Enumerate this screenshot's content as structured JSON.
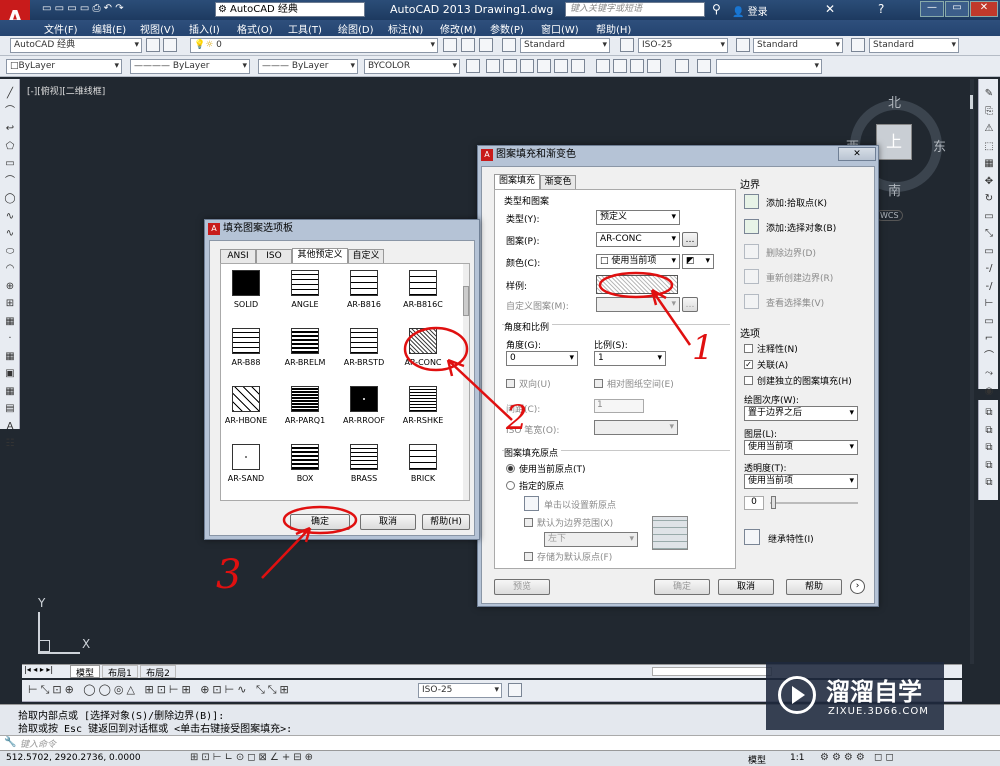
{
  "app": {
    "title_center": "AutoCAD 2013   Drawing1.dwg",
    "search_placeholder": "键入关键字或短语",
    "login_label": "登录",
    "workspace_label": "AutoCAD 经典"
  },
  "menu": [
    "文件(F)",
    "编辑(E)",
    "视图(V)",
    "插入(I)",
    "格式(O)",
    "工具(T)",
    "绘图(D)",
    "标注(N)",
    "修改(M)",
    "参数(P)",
    "窗口(W)",
    "帮助(H)"
  ],
  "toolbar": {
    "workspace_combo": "AutoCAD 经典",
    "layer_combo": "0",
    "text_style": "Standard",
    "dim_style": "ISO-25",
    "table_style": "Standard",
    "mleader_style": "Standard",
    "color_combo": "ByLayer",
    "linetype_combo": "ByLayer",
    "lineweight_combo": "ByLayer",
    "plotstyle_combo": "BYCOLOR"
  },
  "viewport_label": "[-][俯视][二维线框]",
  "viewcube": {
    "north": "北",
    "south": "南",
    "east": "东",
    "west": "西",
    "top": "上",
    "wcs": "WCS"
  },
  "ucs": {
    "x": "X",
    "y": "Y"
  },
  "hatch_dialog": {
    "title": "图案填充和渐变色",
    "tabs": [
      "图案填充",
      "渐变色"
    ],
    "type_group": "类型和图案",
    "type_label": "类型(Y):",
    "type_value": "预定义",
    "pattern_label": "图案(P):",
    "pattern_value": "AR-CONC",
    "color_label": "颜色(C):",
    "color_value": "使用当前项",
    "swatch_label": "样例:",
    "custom_label": "自定义图案(M):",
    "angle_group": "角度和比例",
    "angle_label": "角度(G):",
    "angle_value": "0",
    "scale_label": "比例(S):",
    "scale_value": "1",
    "double_label": "双向(U)",
    "relative_label": "相对图纸空间(E)",
    "spacing_label": "间距(C):",
    "spacing_value": "1",
    "iso_label": "ISO 笔宽(O):",
    "origin_group": "图案填充原点",
    "use_current_origin": "使用当前原点(T)",
    "specified_origin": "指定的原点",
    "click_set_origin": "单击以设置新原点",
    "default_extent": "默认为边界范围(X)",
    "extent_value": "左下",
    "store_default": "存储为默认原点(F)",
    "boundary_title": "边界",
    "add_pick": "添加:拾取点(K)",
    "add_select": "添加:选择对象(B)",
    "remove_boundary": "删除边界(D)",
    "recreate_boundary": "重新创建边界(R)",
    "view_selection": "查看选择集(V)",
    "options_title": "选项",
    "annotative": "注释性(N)",
    "associative": "关联(A)",
    "separate": "创建独立的图案填充(H)",
    "draw_order_label": "绘图次序(W):",
    "draw_order_value": "置于边界之后",
    "layer_label": "图层(L):",
    "layer_value": "使用当前项",
    "transparency_label": "透明度(T):",
    "transparency_value": "使用当前项",
    "transparency_num": "0",
    "inherit_label": "继承特性(I)",
    "preview_btn": "预览",
    "ok_btn": "确定",
    "cancel_btn": "取消",
    "help_btn": "帮助"
  },
  "palette_dialog": {
    "title": "填充图案选项板",
    "tabs": [
      "ANSI",
      "ISO",
      "其他预定义",
      "自定义"
    ],
    "patterns": [
      "SOLID",
      "ANGLE",
      "AR-B816",
      "AR-B816C",
      "AR-B88",
      "AR-BRELM",
      "AR-BRSTD",
      "AR-CONC",
      "AR-HBONE",
      "AR-PARQ1",
      "AR-RROOF",
      "AR-RSHKE",
      "AR-SAND",
      "BOX",
      "BRASS",
      "BRICK"
    ],
    "ok_btn": "确定",
    "cancel_btn": "取消",
    "help_btn": "帮助(H)"
  },
  "annotations": {
    "one": "1",
    "two": "2",
    "three": "3"
  },
  "layout_tabs": [
    "模型",
    "布局1",
    "布局2"
  ],
  "annot_toolbar_combo": "ISO-25",
  "command": {
    "line1": "拾取内部点或 [选择对象(S)/删除边界(B)]:",
    "line2": "拾取或按 Esc 键返回到对话框或 <单击右键接受图案填充>:",
    "prompt_placeholder": "键入命令"
  },
  "status": {
    "coords": "512.5702,  2920.2736, 0.0000",
    "model": "模型",
    "scale": "1:1"
  },
  "watermark": {
    "brand": "溜溜自学",
    "url": "ZIXUE.3D66.COM"
  }
}
